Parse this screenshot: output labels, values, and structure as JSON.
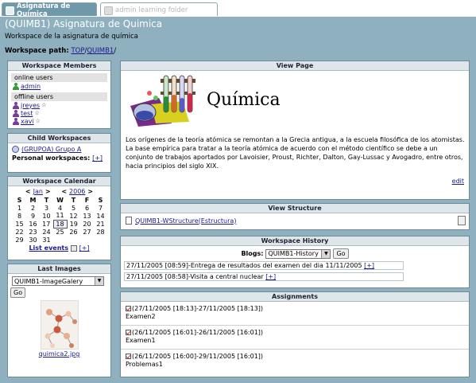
{
  "tabs": [
    {
      "label": "Asignatura de Química",
      "active": true
    },
    {
      "label": "admin learning folder",
      "active": false
    }
  ],
  "workspace": {
    "title": "(QUIMB1) Asignatura de Quimica",
    "description": "Workspace de la asignatura de química",
    "path_label": "Workspace path:",
    "path_root": "TOP",
    "path_sep": "/",
    "path_current": "QUIMB1",
    "path_end": "/"
  },
  "members": {
    "title": "Workspace Members",
    "online_label": "online users",
    "online": [
      "admin"
    ],
    "offline_label": "offline users",
    "offline": [
      "jreyes",
      "test",
      "xavi"
    ]
  },
  "child": {
    "title": "Child Workspaces",
    "item": "(GRUPOA) Grupo A",
    "personal_label": "Personal workspaces:",
    "personal_add": "[+]"
  },
  "calendar": {
    "title": "Workspace Calendar",
    "prev": "<",
    "month": "Jan",
    "next": ">",
    "prev_year": "<",
    "year": "2006",
    "next_year": ">",
    "days": [
      "S",
      "M",
      "T",
      "W",
      "T",
      "F",
      "S"
    ],
    "weeks": [
      [
        "1",
        "2",
        "3",
        "4",
        "5",
        "6",
        "7"
      ],
      [
        "8",
        "9",
        "10",
        "11",
        "12",
        "13",
        "14"
      ],
      [
        "15",
        "16",
        "17",
        "18",
        "19",
        "20",
        "21"
      ],
      [
        "22",
        "23",
        "24",
        "25",
        "26",
        "27",
        "28"
      ],
      [
        "29",
        "30",
        "31",
        "",
        "",
        "",
        ""
      ]
    ],
    "today": "18",
    "list_events": "List events",
    "add": "[+]"
  },
  "images": {
    "title": "Last Images",
    "gallery": "QUIMB1-ImageGalery",
    "go": "Go",
    "caption": "quimica2.jpg"
  },
  "view_page": {
    "title": "View Page",
    "heading": "Química",
    "text": "Los orígenes de la teoría atómica se remontan a la Grecia antigua, a la escuela filosófica de los atomistas. La base empírica para tratar a la teoría atómica de acuerdo con el método científico se debe a un conjunto de trabajos aportados por Lavoisier, Proust, Richter, Dalton, Gay-Lussac y Avogadro, entre otros, hacia principios del siglo XIX.",
    "edit": "edit"
  },
  "structure": {
    "title": "View Structure",
    "item": "QUIMB1-WStructure(Estructura)"
  },
  "history": {
    "title": "Workspace History",
    "blogs_label": "Blogs:",
    "blog": "QUIMB1-History",
    "go": "Go",
    "entries": [
      {
        "text": "27/11/2005 [08:59]-Entrega de resultados del examen del dia 11/11/2005",
        "add": "[+]"
      },
      {
        "text": "27/11/2005 [08:58]-Visita a central nuclear",
        "add": "[+]"
      }
    ]
  },
  "assignments": {
    "title": "Assignments",
    "items": [
      {
        "dates": "(27/11/2005 [18:13]-27/11/2005 [18:13])",
        "name": "Examen2"
      },
      {
        "dates": "(26/11/2005 [16:01]-26/11/2005 [16:01])",
        "name": "Examen1"
      },
      {
        "dates": "(26/11/2005 [16:00]-29/11/2005 [16:01])",
        "name": "Problemas1"
      }
    ]
  },
  "colors": {
    "background": "#8fb0bf",
    "tab_active": "#6f98aa",
    "panel_title": "#dfe6ea"
  }
}
